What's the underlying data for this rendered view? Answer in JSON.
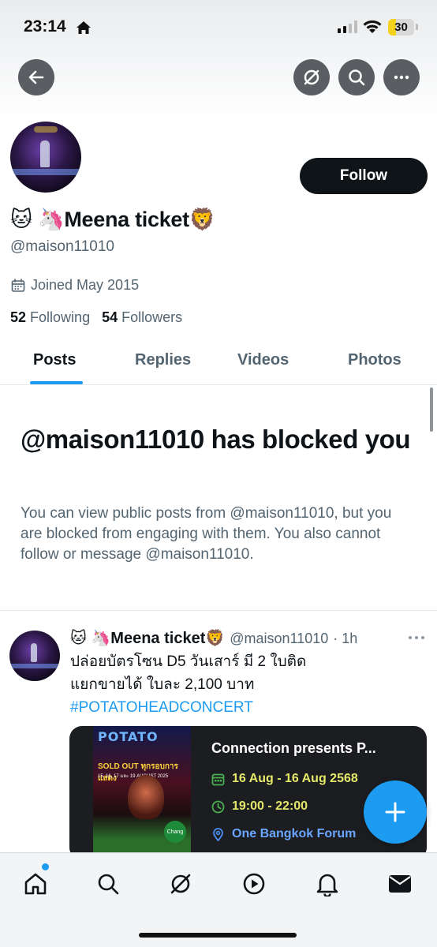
{
  "status_bar": {
    "time": "23:14",
    "battery": "30",
    "battery_level": 0.3,
    "accent": "#f4d21c"
  },
  "header": {
    "back_icon": "arrow-left-icon",
    "explore_icon": "explore-slash-icon",
    "search_icon": "search-icon",
    "more_icon": "more-horizontal-icon"
  },
  "profile": {
    "display_name": "🐱 🦄Meena ticket🦁",
    "handle": "@maison11010",
    "follow_label": "Follow",
    "joined": "Joined May 2015",
    "following_count": "52",
    "following_label": "Following",
    "followers_count": "54",
    "followers_label": "Followers"
  },
  "tabs": [
    {
      "label": "Posts",
      "active": true
    },
    {
      "label": "Replies",
      "active": false
    },
    {
      "label": "Videos",
      "active": false
    },
    {
      "label": "Photos",
      "active": false
    }
  ],
  "blocked": {
    "title": "@maison11010 has blocked you",
    "body": "You can view public posts from @maison11010, but you are blocked from engaging with them. You also cannot follow or message @maison11010."
  },
  "post": {
    "author": "🐱 🦄Meena ticket🦁",
    "handle": "@maison11010",
    "time": "· 1h",
    "line1": "ปล่อยบัตรโซน D5 วันเสาร์ มี 2 ใบติด",
    "line2": "แยกขายได้ ใบละ 2,100 บาท",
    "hashtag": "#POTATOHEADCONCERT",
    "card": {
      "poster_title": "POTATO",
      "poster_soldout": "SOLD OUT ทุกรอบการแสดง",
      "poster_dates": "15, 16, 17 และ 19 AUGUST 2025",
      "poster_badge": "Chang",
      "title": "Connection presents P...",
      "date": "16 Aug - 16 Aug 2568",
      "time": "19:00 - 22:00",
      "venue": "One Bangkok Forum"
    }
  },
  "fab": {
    "icon": "plus-icon"
  },
  "bottom_nav": [
    {
      "name": "home-icon"
    },
    {
      "name": "search-icon"
    },
    {
      "name": "grok-icon"
    },
    {
      "name": "video-play-icon"
    },
    {
      "name": "bell-icon"
    },
    {
      "name": "mail-icon"
    }
  ],
  "colors": {
    "brand_blue": "#1d9bf0",
    "text_primary": "#0f1419",
    "text_secondary": "#536471"
  }
}
